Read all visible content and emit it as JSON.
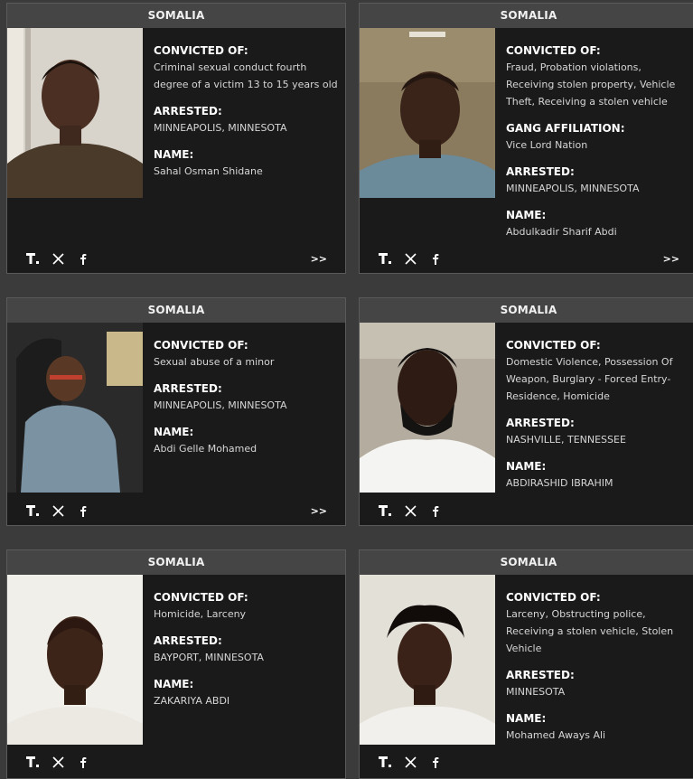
{
  "cards": [
    {
      "country": "SOMALIA",
      "fields": [
        {
          "label": "CONVICTED OF:",
          "value": "Criminal sexual conduct fourth degree of a victim 13 to 15 years old"
        },
        {
          "label": "ARRESTED:",
          "value": "MINNEAPOLIS, MINNESOTA"
        },
        {
          "label": "NAME:",
          "value": "Sahal Osman Shidane"
        }
      ],
      "more": ">>"
    },
    {
      "country": "SOMALIA",
      "fields": [
        {
          "label": "CONVICTED OF:",
          "value": "Fraud, Probation violations, Receiving stolen property, Vehicle Theft, Receiving a stolen vehicle"
        },
        {
          "label": "GANG AFFILIATION:",
          "value": "Vice Lord Nation"
        },
        {
          "label": "ARRESTED:",
          "value": "MINNEAPOLIS, MINNESOTA"
        },
        {
          "label": "NAME:",
          "value": "Abdulkadir Sharif Abdi"
        }
      ],
      "more": ">>"
    },
    {
      "country": "SOMALIA",
      "fields": [
        {
          "label": "CONVICTED OF:",
          "value": "Sexual abuse of a minor"
        },
        {
          "label": "ARRESTED:",
          "value": "MINNEAPOLIS, MINNESOTA"
        },
        {
          "label": "NAME:",
          "value": "Abdi Gelle Mohamed"
        }
      ],
      "more": ">>"
    },
    {
      "country": "SOMALIA",
      "fields": [
        {
          "label": "CONVICTED OF:",
          "value": "Domestic Violence, Possession Of Weapon, Burglary - Forced Entry-Residence, Homicide"
        },
        {
          "label": "ARRESTED:",
          "value": "NASHVILLE, TENNESSEE"
        },
        {
          "label": "NAME:",
          "value": "ABDIRASHID IBRAHIM"
        }
      ]
    },
    {
      "country": "SOMALIA",
      "fields": [
        {
          "label": "CONVICTED OF:",
          "value": "Homicide, Larceny"
        },
        {
          "label": "ARRESTED:",
          "value": "BAYPORT, MINNESOTA"
        },
        {
          "label": "NAME:",
          "value": "ZAKARIYA ABDI"
        }
      ]
    },
    {
      "country": "SOMALIA",
      "fields": [
        {
          "label": "CONVICTED OF:",
          "value": "Larceny, Obstructing police, Receiving a stolen vehicle, Stolen Vehicle"
        },
        {
          "label": "ARRESTED:",
          "value": "MINNESOTA"
        },
        {
          "label": "NAME:",
          "value": "Mohamed Aways Ali"
        }
      ]
    }
  ],
  "share_icons": [
    "truth-social-icon",
    "x-icon",
    "facebook-icon"
  ],
  "colors": {
    "background": "#3b3b3b",
    "card": "#1a1a1a",
    "header": "#454545"
  }
}
